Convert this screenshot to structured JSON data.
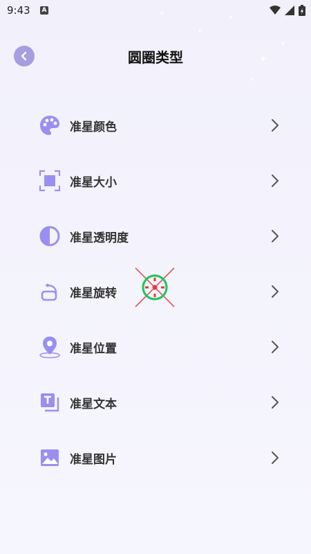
{
  "status": {
    "time": "9:43",
    "badge": "A"
  },
  "header": {
    "title": "圆圈类型"
  },
  "items": [
    {
      "label": "准星颜色",
      "icon": "palette-icon"
    },
    {
      "label": "准星大小",
      "icon": "resize-square-icon"
    },
    {
      "label": "准星透明度",
      "icon": "contrast-icon"
    },
    {
      "label": "准星旋转",
      "icon": "rotate-icon"
    },
    {
      "label": "准星位置",
      "icon": "location-pin-icon"
    },
    {
      "label": "准星文本",
      "icon": "text-box-icon"
    },
    {
      "label": "准星图片",
      "icon": "image-icon"
    }
  ],
  "colors": {
    "accent": "#9a8ff0",
    "back_button": "#a69ee0",
    "background": "#f3f2fd",
    "chevron": "#555555"
  }
}
